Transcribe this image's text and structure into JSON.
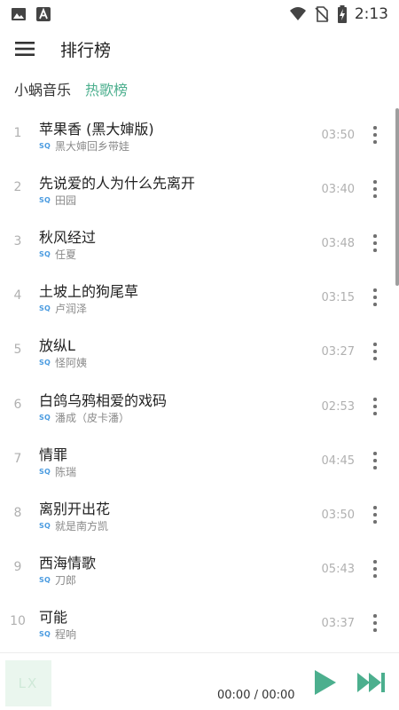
{
  "status_bar": {
    "time": "2:13",
    "icons": [
      "image-icon",
      "app-a-icon",
      "wifi-icon",
      "no-sim-icon",
      "battery-charging-icon"
    ]
  },
  "app_bar": {
    "title": "排行榜"
  },
  "tabs": {
    "source": "小蜗音乐",
    "list": "热歌榜"
  },
  "accent_color": "#4caf8e",
  "quality_badge": "SQ",
  "songs": [
    {
      "index": "1",
      "title": "苹果香 (黑大婶版)",
      "artist": "黑大婶回乡带娃",
      "duration": "03:50"
    },
    {
      "index": "2",
      "title": "先说爱的人为什么先离开",
      "artist": "田园",
      "duration": "03:40"
    },
    {
      "index": "3",
      "title": "秋风经过",
      "artist": "任夏",
      "duration": "03:48"
    },
    {
      "index": "4",
      "title": "土坡上的狗尾草",
      "artist": "卢润泽",
      "duration": "03:15"
    },
    {
      "index": "5",
      "title": "放纵L",
      "artist": "怪阿姨",
      "duration": "03:27"
    },
    {
      "index": "6",
      "title": "白鸽乌鸦相爱的戏码",
      "artist": "潘成（皮卡潘）",
      "duration": "02:53"
    },
    {
      "index": "7",
      "title": "情罪",
      "artist": "陈瑞",
      "duration": "04:45"
    },
    {
      "index": "8",
      "title": "离别开出花",
      "artist": "就是南方凯",
      "duration": "03:50"
    },
    {
      "index": "9",
      "title": "西海情歌",
      "artist": "刀郎",
      "duration": "05:43"
    },
    {
      "index": "10",
      "title": "可能",
      "artist": "程响",
      "duration": "03:37"
    }
  ],
  "player": {
    "cover_text": "LX",
    "time": "00:00 / 00:00"
  }
}
